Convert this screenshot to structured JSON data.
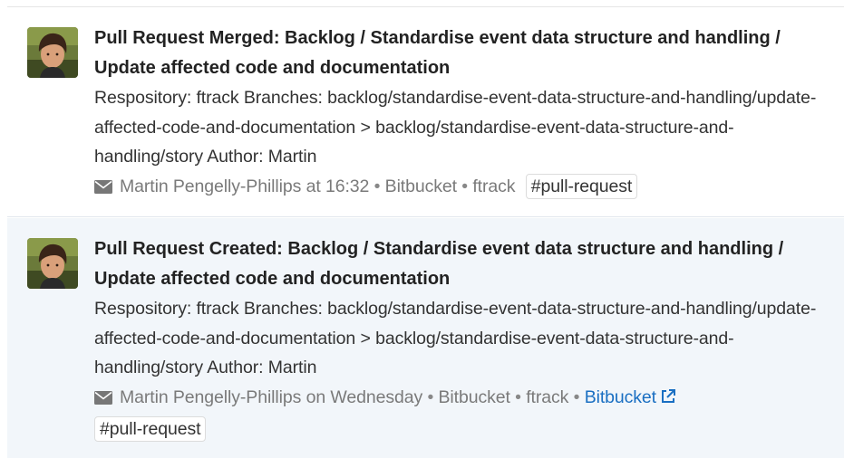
{
  "feed": {
    "items": [
      {
        "title": "Pull Request Merged: Backlog / Standardise event data structure and handling / Update affected code and documentation",
        "body": "Respository: ftrack Branches: backlog/standardise-event-data-structure-and-handling/update-affected-code-and-documentation > backlog/standardise-event-data-structure-and-handling/story Author: Martin",
        "meta": {
          "icon": "envelope-icon",
          "author_time": "Martin Pengelly-Phillips at 16:32",
          "separator": "•",
          "source": "Bitbucket",
          "project": "ftrack"
        },
        "tag": "#pull-request"
      },
      {
        "title": "Pull Request Created: Backlog / Standardise event data structure and handling / Update affected code and documentation",
        "body": "Respository: ftrack Branches: backlog/standardise-event-data-structure-and-handling/update-affected-code-and-documentation > backlog/standardise-event-data-structure-and-handling/story Author: Martin",
        "meta": {
          "icon": "envelope-icon",
          "author_time": "Martin Pengelly-Phillips on Wednesday",
          "separator": "•",
          "source": "Bitbucket",
          "project": "ftrack",
          "link_label": "Bitbucket",
          "link_icon": "external-link-icon"
        },
        "tag": "#pull-request"
      }
    ]
  },
  "colors": {
    "highlight_background": "#f2f6fa",
    "link": "#1a6fc2",
    "meta_text": "#7a7a7a"
  }
}
